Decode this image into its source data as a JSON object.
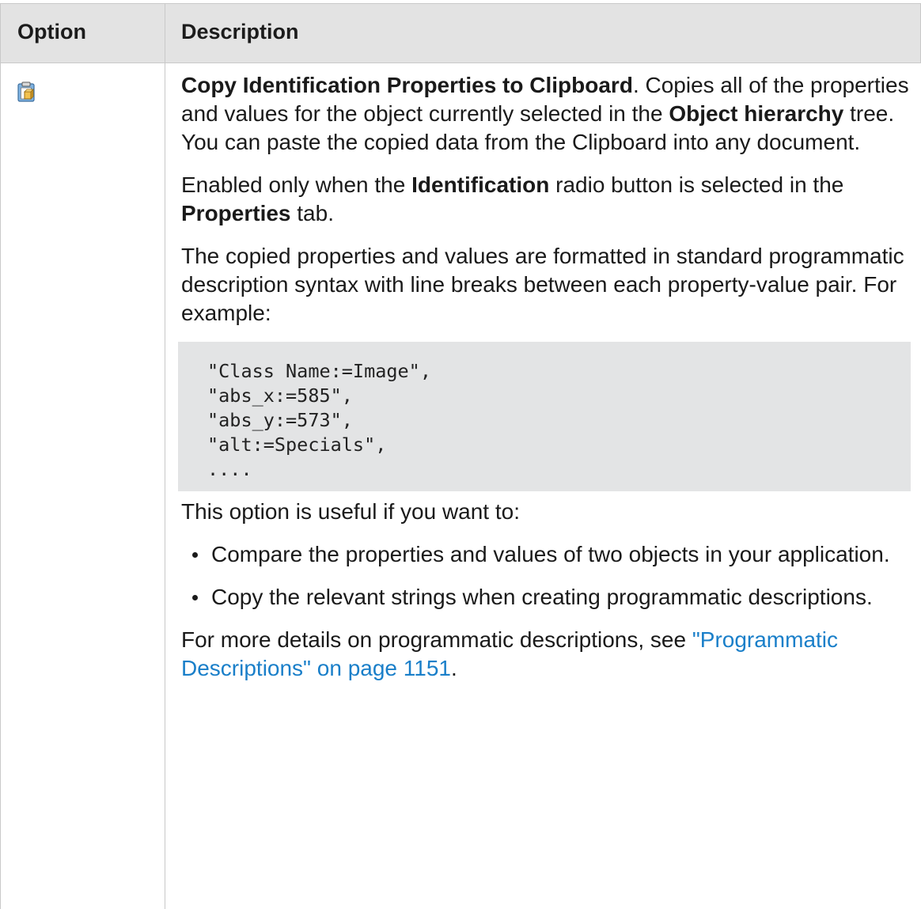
{
  "table": {
    "header": {
      "option": "Option",
      "description": "Description"
    },
    "row": {
      "icon": "copy-to-clipboard-icon",
      "title_bold": "Copy Identification Properties to Clipboard",
      "intro_after_title": ". Copies all of the properties and values for the object currently selected in the ",
      "object_hierarchy_bold": "Object hierarchy",
      "intro_end": " tree. You can paste the copied data from the Clipboard into any document.",
      "enabled_prefix": "Enabled only when the ",
      "identification_bold": "Identification",
      "enabled_mid": " radio button is selected in the ",
      "properties_bold": "Properties",
      "enabled_end": " tab.",
      "format_text": "The copied properties and values are formatted in standard programmatic description syntax with line breaks between each property-value pair. For example:",
      "code_lines": [
        "\"Class Name:=Image\",",
        "\"abs_x:=585\",",
        "\"abs_y:=573\",",
        "\"alt:=Specials\",",
        "...."
      ],
      "useful_text": "This option is useful if you want to:",
      "bullets": [
        "Compare the properties and values of two objects in your application.",
        "Copy the relevant strings when creating programmatic descriptions."
      ],
      "more_details_text": "For more details on programmatic descriptions, see ",
      "link_text": "\"Programmatic Descriptions\" on page 1151",
      "more_details_end": "."
    }
  },
  "colors": {
    "header_bg": "#e3e3e3",
    "code_bg": "#e3e4e5",
    "link": "#1a7fc9",
    "border": "#c9c9c9"
  }
}
